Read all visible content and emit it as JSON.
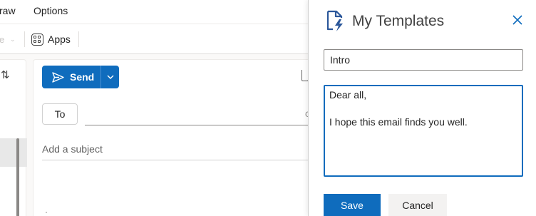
{
  "menubar": {
    "draw_label": "raw",
    "options_label": "Options"
  },
  "ribbon": {
    "cut_item_label": "e",
    "apps_label": "Apps"
  },
  "message_list": {
    "sort_icon": "sort-arrows-icon"
  },
  "compose": {
    "send_label": "Send",
    "to_label": "To",
    "cc_hint": "C",
    "subject_placeholder": "Add a subject"
  },
  "task_pane": {
    "title": "My Templates",
    "logo_icon": "document-lightning-icon",
    "close_icon": "close-icon",
    "template_name_value": "Intro",
    "template_body_value": "Dear all,\n\nI hope this email finds you well.",
    "save_label": "Save",
    "cancel_label": "Cancel"
  },
  "colors": {
    "accent": "#0f6cbd",
    "pane_background": "#ffffff",
    "app_background": "#faf9f8"
  }
}
